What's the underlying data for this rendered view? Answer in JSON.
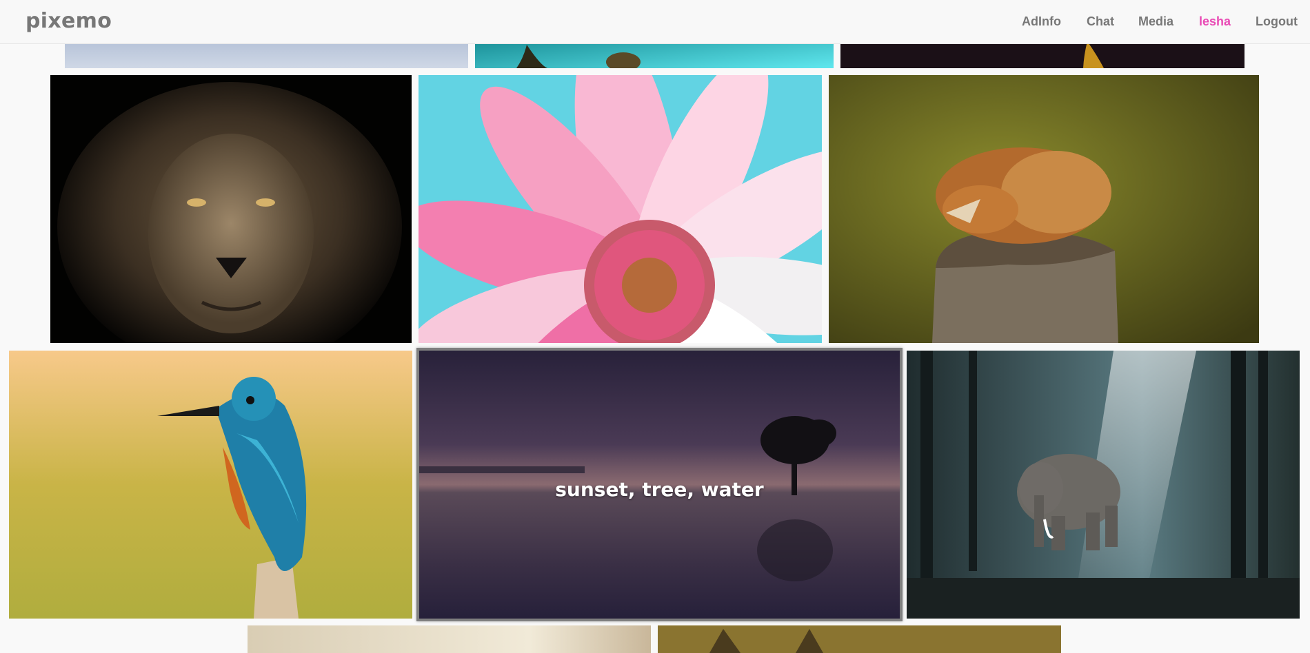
{
  "navbar": {
    "brand": "pixemo",
    "links": [
      {
        "label": "AdInfo",
        "color": "#777777"
      },
      {
        "label": "Chat",
        "color": "#777777"
      },
      {
        "label": "Media",
        "color": "#777777"
      },
      {
        "label": "lesha",
        "color": "#e94bb5"
      },
      {
        "label": "Logout",
        "color": "#777777"
      }
    ]
  },
  "gallery": {
    "hovered_caption": "sunset, tree, water",
    "photos": [
      {
        "subject": "sky"
      },
      {
        "subject": "turtle"
      },
      {
        "subject": "dark"
      },
      {
        "subject": "lion"
      },
      {
        "subject": "pink-daisy"
      },
      {
        "subject": "sleeping-fox"
      },
      {
        "subject": "kingfisher"
      },
      {
        "subject": "sunset-tree-lake"
      },
      {
        "subject": "elephant-forest"
      },
      {
        "subject": "beige"
      },
      {
        "subject": "wildcat"
      }
    ]
  }
}
